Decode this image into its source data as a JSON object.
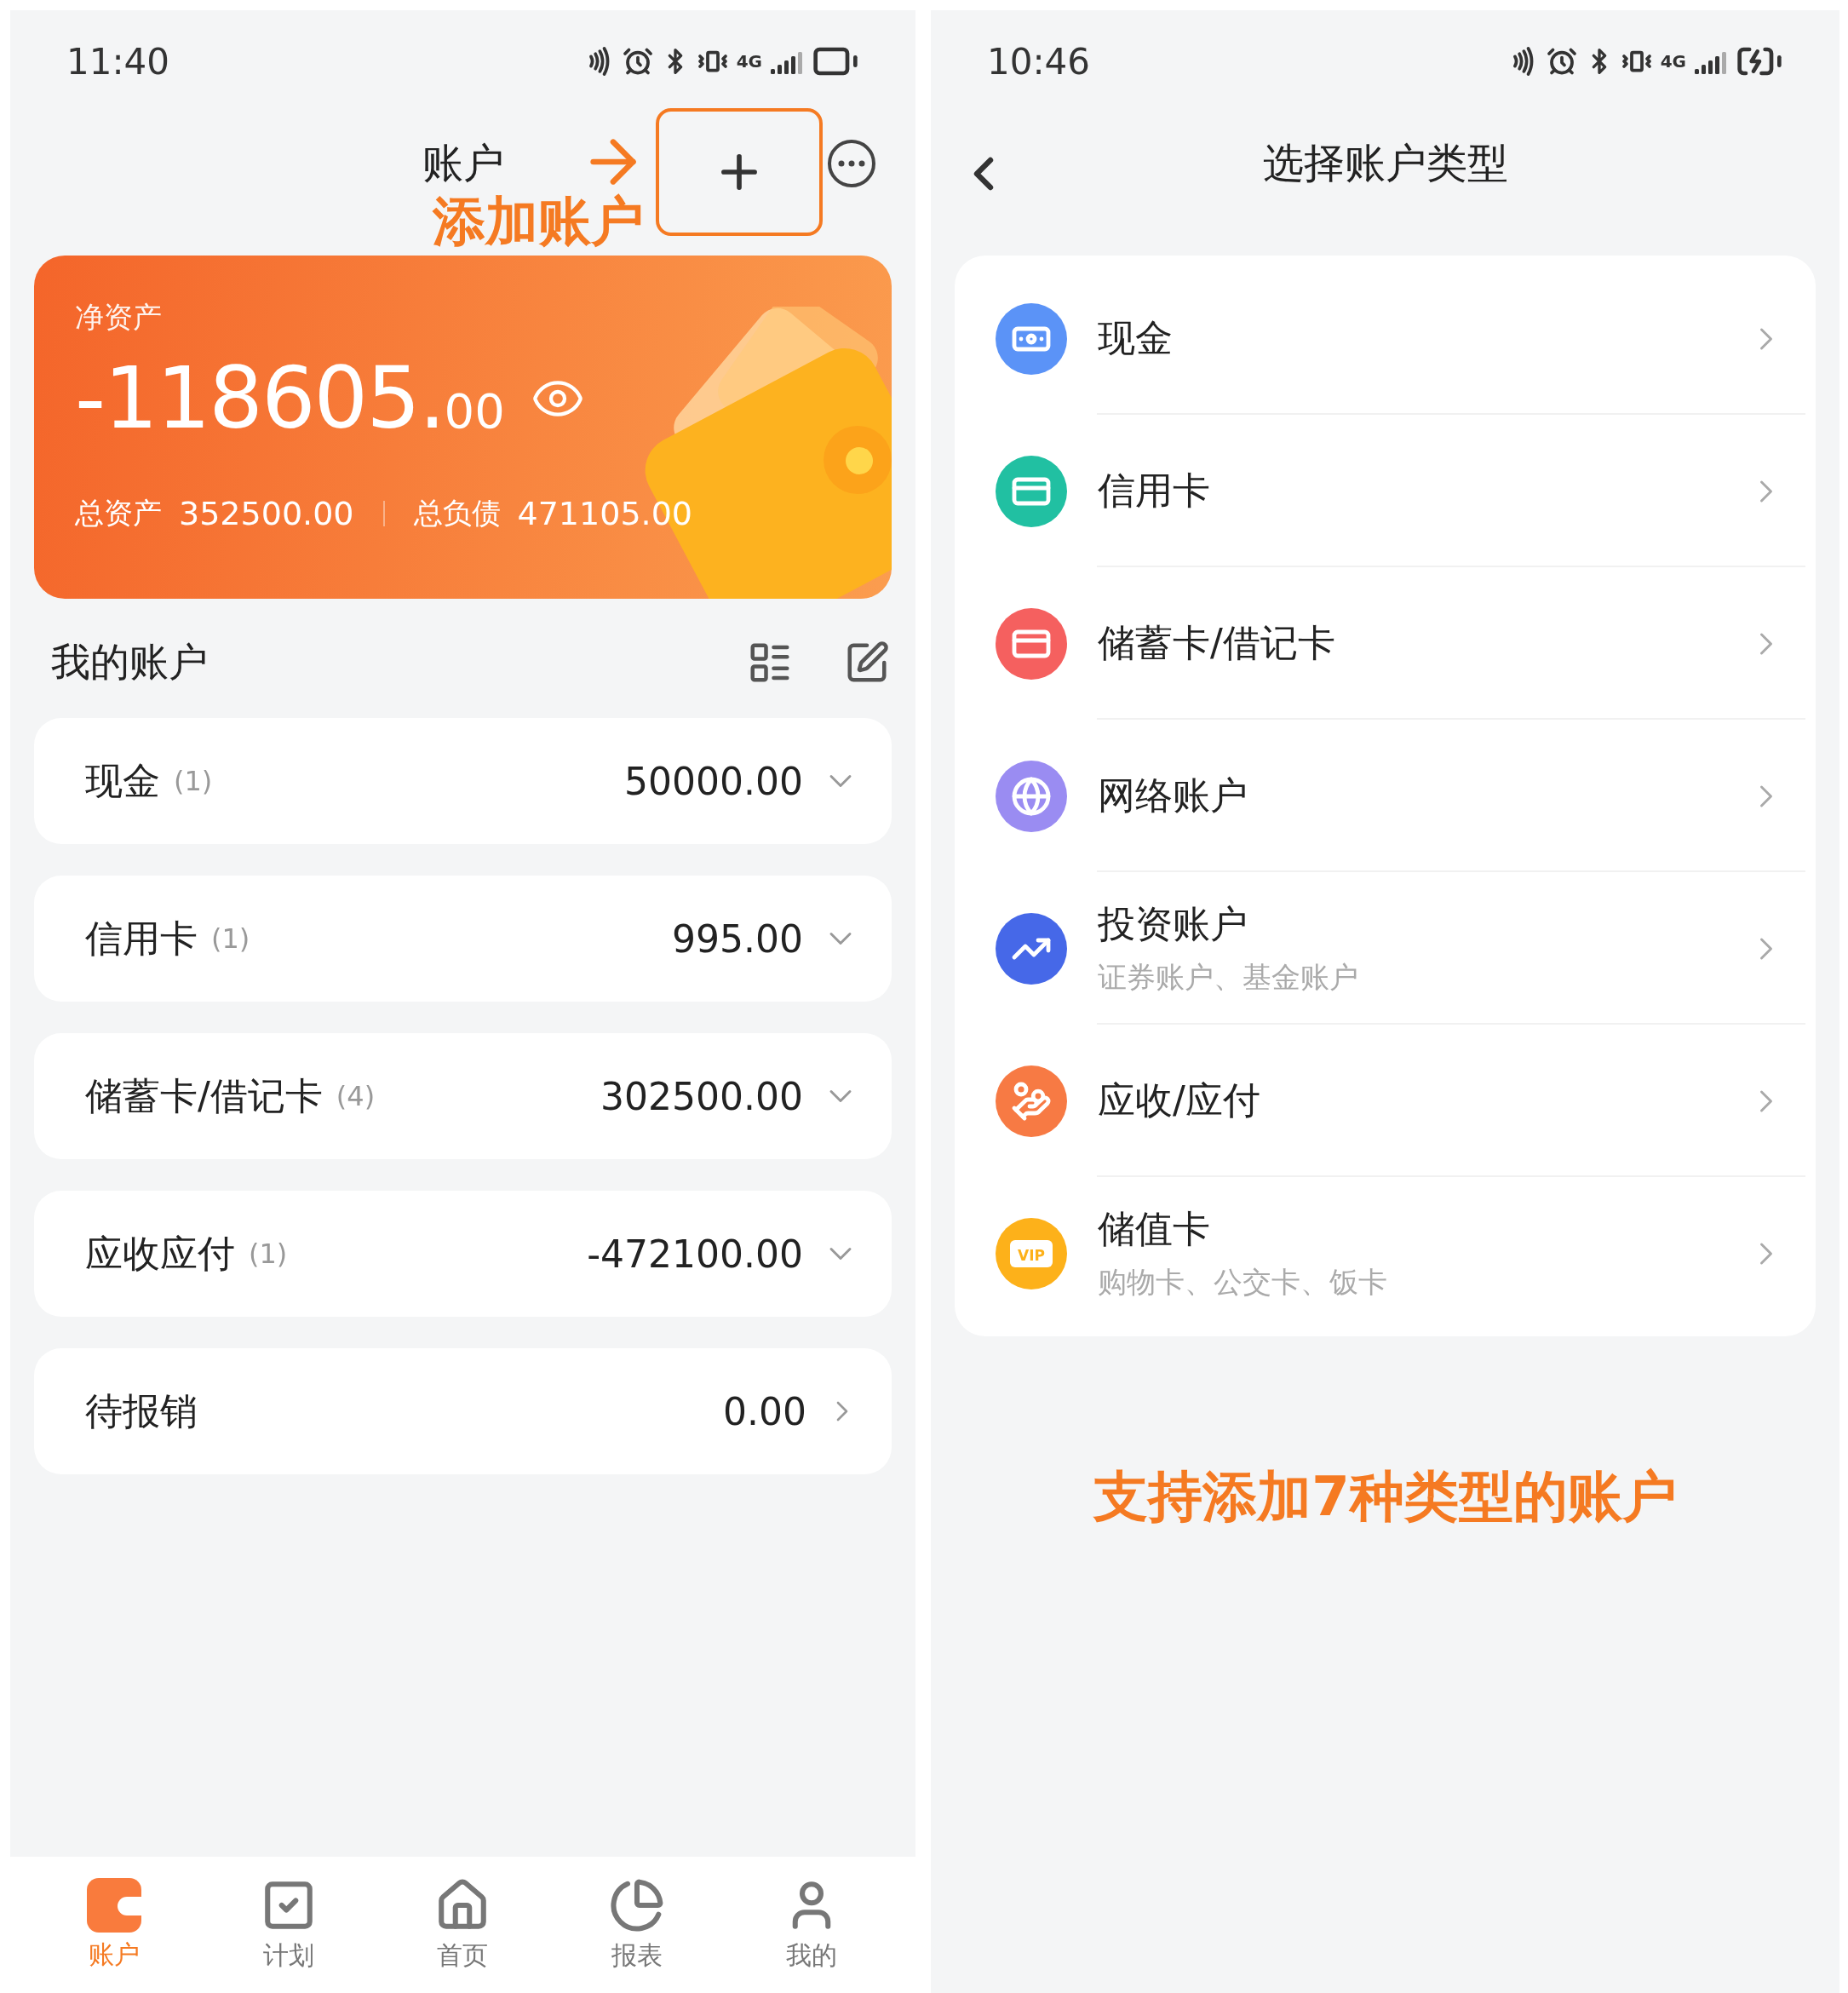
{
  "account_screen": {
    "status_bar": {
      "time": "11:40",
      "network": "4G",
      "charging": false
    },
    "header": {
      "title": "账户"
    },
    "annotation": {
      "label": "添加账户"
    },
    "summary_card": {
      "label": "净资产",
      "net_integer": "-118605.",
      "net_decimal": "00",
      "assets_label": "总资产",
      "assets_value": "352500.00",
      "liabilities_label": "总负债",
      "liabilities_value": "471105.00"
    },
    "section": {
      "title": "我的账户"
    },
    "accounts": [
      {
        "kind": "group",
        "name": "现金",
        "count": "(1)",
        "amount": "50000.00"
      },
      {
        "kind": "group",
        "name": "信用卡",
        "count": "(1)",
        "amount": "995.00"
      },
      {
        "kind": "group",
        "name": "储蓄卡/借记卡",
        "count": "(4)",
        "amount": "302500.00"
      },
      {
        "kind": "group",
        "name": "应收应付",
        "count": "(1)",
        "amount": "-472100.00"
      },
      {
        "kind": "link",
        "name": "待报销",
        "amount": "0.00"
      }
    ],
    "tab_bar": [
      {
        "kind": "wallet",
        "label": "账户",
        "selected": true
      },
      {
        "kind": "plan",
        "label": "计划",
        "selected": false
      },
      {
        "kind": "home",
        "label": "首页",
        "selected": false
      },
      {
        "kind": "report",
        "label": "报表",
        "selected": false
      },
      {
        "kind": "profile",
        "label": "我的",
        "selected": false
      }
    ]
  },
  "type_screen": {
    "status_bar": {
      "time": "10:46",
      "network": "4G",
      "charging": true
    },
    "header": {
      "title": "选择账户类型"
    },
    "types": [
      {
        "kind": "cash",
        "name": "现金",
        "color": "#5b93f7"
      },
      {
        "kind": "credit",
        "name": "信用卡",
        "color": "#21c0a2"
      },
      {
        "kind": "debit",
        "name": "储蓄卡/借记卡",
        "color": "#f5605f"
      },
      {
        "kind": "online",
        "name": "网络账户",
        "color": "#9a8cf2"
      },
      {
        "kind": "invest",
        "name": "投资账户",
        "subtitle": "证券账户、基金账户",
        "color": "#4668e8"
      },
      {
        "kind": "receivable",
        "name": "应收/应付",
        "color": "#f77a44"
      },
      {
        "kind": "stored",
        "name": "储值卡",
        "subtitle": "购物卡、公交卡、饭卡",
        "badge": "VIP",
        "color": "#fdb11a"
      }
    ],
    "annotation": "支持添加7种类型的账户"
  }
}
